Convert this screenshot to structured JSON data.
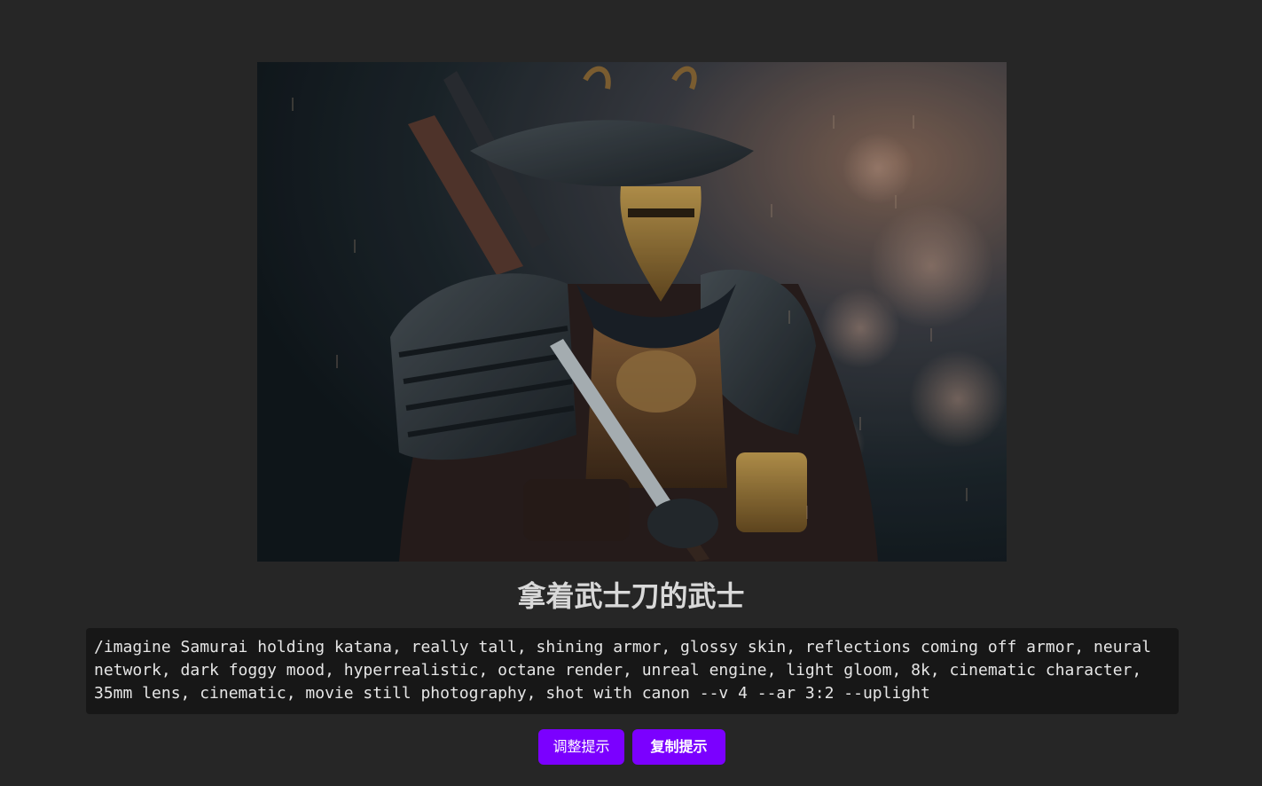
{
  "artwork": {
    "image_subject": "samurai-warrior-artwork",
    "palette": {
      "background": "#262626",
      "accent": "#7b00ff",
      "prompt_bg": "#171717"
    }
  },
  "title": "拿着武士刀的武士",
  "prompt": "/imagine Samurai holding katana, really tall, shining armor, glossy skin, reflections coming off armor, neural network, dark foggy mood, hyperrealistic, octane render, unreal engine, light gloom, 8k, cinematic character, 35mm lens, cinematic, movie still photography, shot with canon --v 4 --ar 3:2 --uplight",
  "actions": {
    "adjust_label": "调整提示",
    "copy_label": "复制提示"
  }
}
